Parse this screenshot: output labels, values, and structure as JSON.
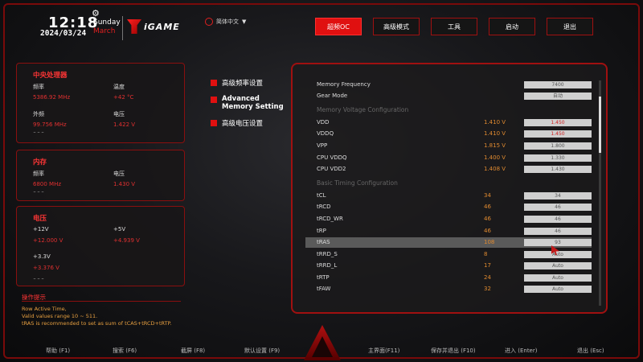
{
  "header": {
    "time": "12:18",
    "date": "2024/03/24",
    "weekday": "Sunday",
    "month": "March",
    "brand": "iGAME",
    "language": "简体中文",
    "nav": [
      {
        "label": "超频OC",
        "active": true
      },
      {
        "label": "高级模式",
        "active": false
      },
      {
        "label": "工具",
        "active": false
      },
      {
        "label": "启动",
        "active": false
      },
      {
        "label": "退出",
        "active": false
      }
    ]
  },
  "cpu": {
    "title": "中央处理器",
    "freq_label": "频率",
    "freq_value": "5386.92 MHz",
    "temp_label": "温度",
    "temp_value": "+42 °C",
    "bclk_label": "外频",
    "bclk_value": "99.756 MHz",
    "volt_label": "电压",
    "volt_value": "1.422 V"
  },
  "memory": {
    "title": "内存",
    "freq_label": "频率",
    "freq_value": "6800 MHz",
    "volt_label": "电压",
    "volt_value": "1.430 V"
  },
  "voltage": {
    "title": "电压",
    "v12_label": "+12V",
    "v12_value": "+12.000 V",
    "v5_label": "+5V",
    "v5_value": "+4.939 V",
    "v33_label": "+3.3V",
    "v33_value": "+3.376 V"
  },
  "help": {
    "title": "操作提示",
    "lines": [
      "Row Active Time,",
      "Valid values range 10 ~ 511.",
      "tRAS is recommended to set as sum of tCAS+tRCD+tRTP."
    ]
  },
  "menu": [
    "高级频率设置",
    "Advanced Memory Setting",
    "高级电压设置"
  ],
  "settings": {
    "top_rows": [
      {
        "name": "Memory Frequency",
        "value": "",
        "box": "7400"
      },
      {
        "name": "Gear Mode",
        "value": "",
        "box": "自动"
      }
    ],
    "section_voltage": "Memory Voltage Configuration",
    "voltage_rows": [
      {
        "name": "VDD",
        "value": "1.410 V",
        "box": "1.450",
        "red": true
      },
      {
        "name": "VDDQ",
        "value": "1.410 V",
        "box": "1.450",
        "red": true
      },
      {
        "name": "VPP",
        "value": "1.815 V",
        "box": "1.800",
        "red": false
      },
      {
        "name": "CPU VDDQ",
        "value": "1.400 V",
        "box": "1.330",
        "red": false
      },
      {
        "name": "CPU VDD2",
        "value": "1.408 V",
        "box": "1.430",
        "red": false
      }
    ],
    "section_timing": "Basic Timing Configuration",
    "timing_rows": [
      {
        "name": "tCL",
        "value": "34",
        "box": "34"
      },
      {
        "name": "tRCD",
        "value": "46",
        "box": "46"
      },
      {
        "name": "tRCD_WR",
        "value": "46",
        "box": "46"
      },
      {
        "name": "tRP",
        "value": "46",
        "box": "46"
      },
      {
        "name": "tRAS",
        "value": "108",
        "box": "93",
        "selected": true
      },
      {
        "name": "tRRD_S",
        "value": "8",
        "box": "Auto"
      },
      {
        "name": "tRRD_L",
        "value": "17",
        "box": "Auto"
      },
      {
        "name": "tRTP",
        "value": "24",
        "box": "Auto"
      },
      {
        "name": "tFAW",
        "value": "32",
        "box": "Auto"
      }
    ]
  },
  "footer": [
    "帮助 (F1)",
    "搜索 (F6)",
    "截屏 (F8)",
    "默认设置 (F9)",
    "主界面(F11)",
    "保存并退出 (F10)",
    "进入 (Enter)",
    "退出 (Esc)"
  ],
  "colors": {
    "accent": "#e01010",
    "value": "#e08a30",
    "help": "#e8a040"
  }
}
